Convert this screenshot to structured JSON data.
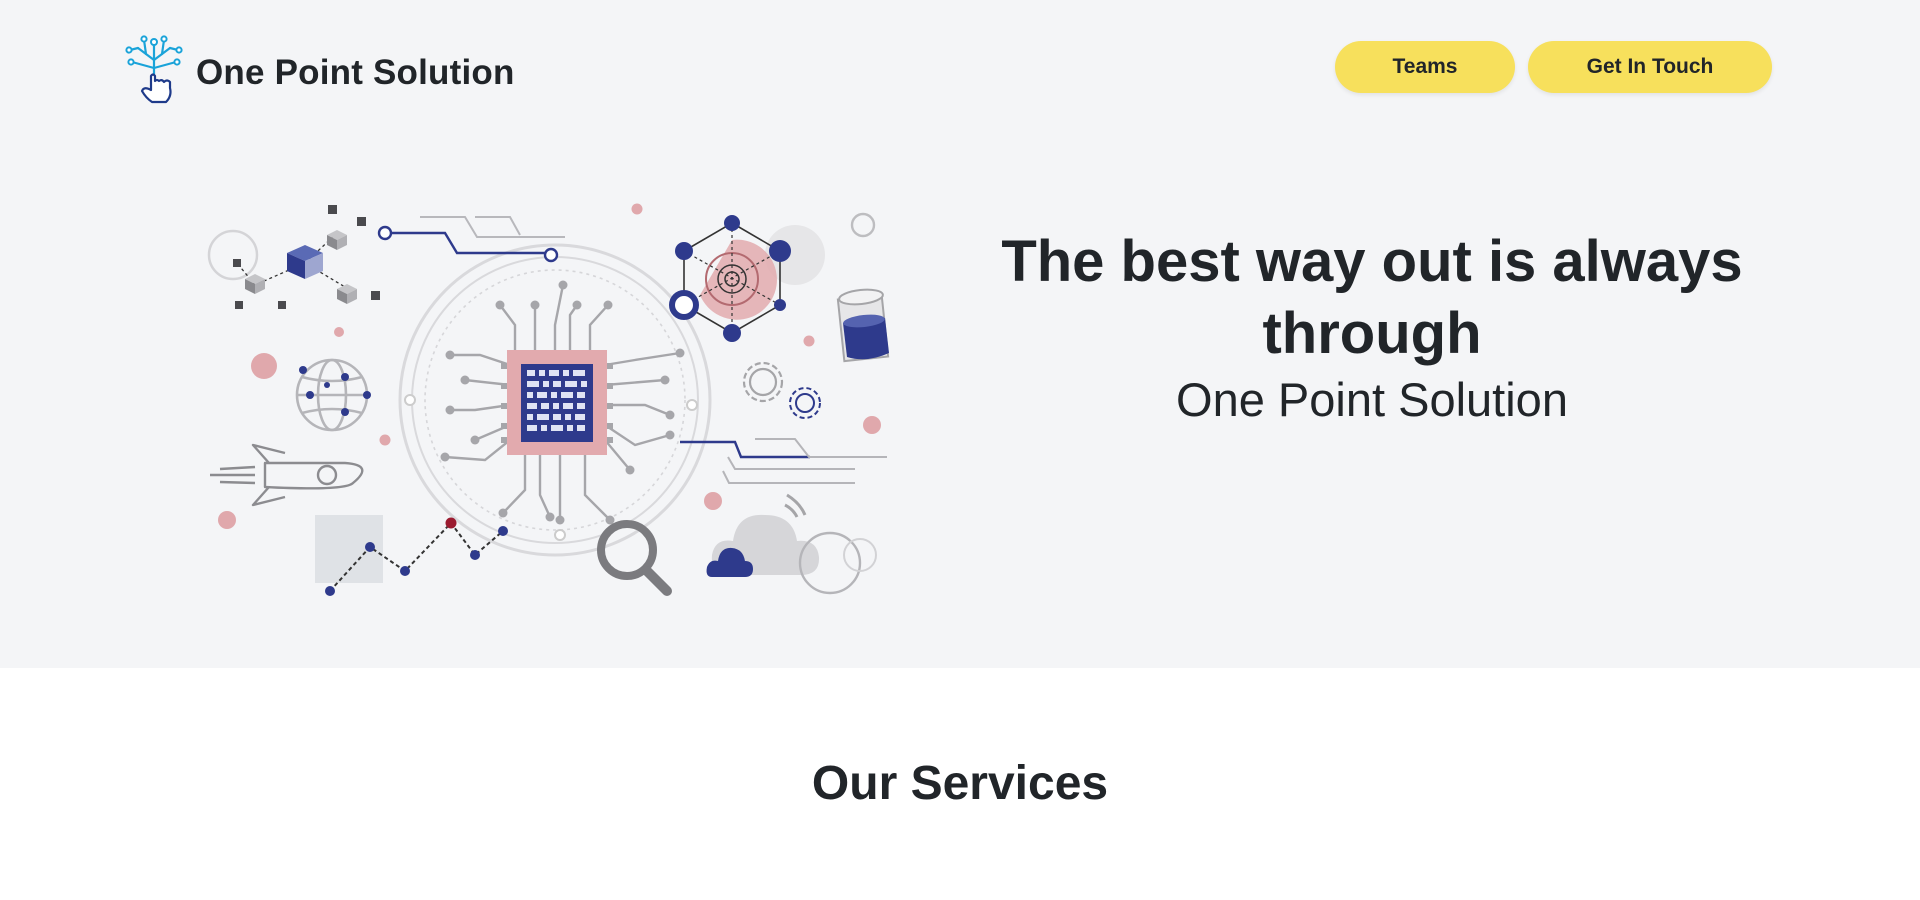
{
  "header": {
    "brand": "One Point Solution",
    "logo_icon": "touch-circuit-icon",
    "nav": {
      "teams_label": "Teams",
      "contact_label": "Get In Touch"
    }
  },
  "hero": {
    "headline": "The best way out is always through",
    "subheadline": "One Point Solution",
    "illustration": "technology-circuit-illustration"
  },
  "services": {
    "title": "Our Services"
  },
  "colors": {
    "hero_background": "#f4f5f7",
    "button_yellow": "#f7e05c",
    "text_dark": "#212529",
    "navy": "#2e3a8c",
    "pink": "#e0a8ac",
    "logo_cyan": "#1aa3d9"
  }
}
